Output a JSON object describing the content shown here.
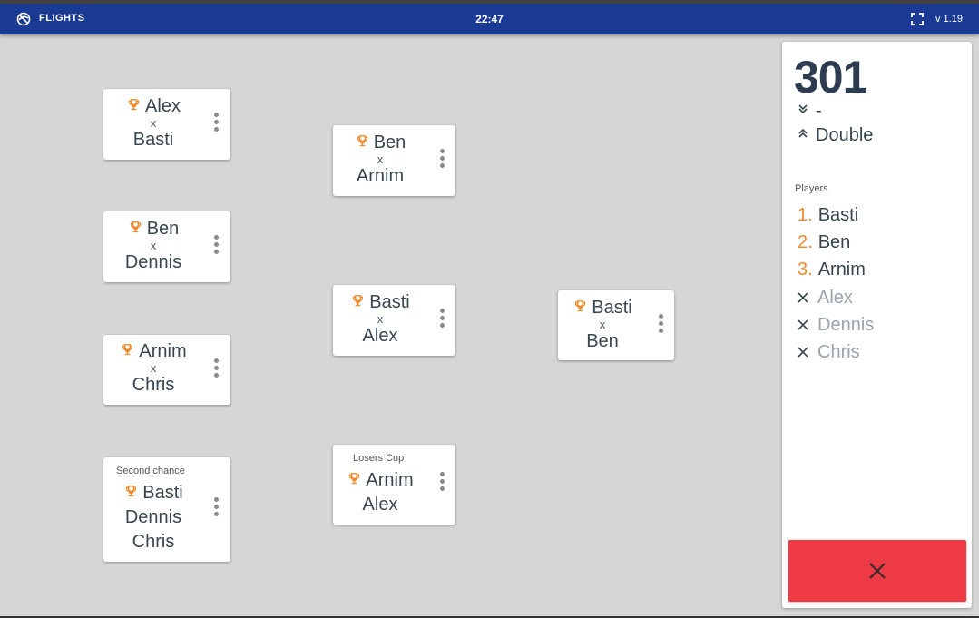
{
  "appbar": {
    "title": "FLIGHTS",
    "clock": "22:47",
    "version": "v 1.19",
    "bg_color": "#1a3a94",
    "fullscreen_icon": "fullscreen-icon",
    "logo_icon": "darts-logo-icon"
  },
  "bracket": {
    "x_label": "x",
    "round1": [
      {
        "winner": "Alex",
        "opponent": "Basti"
      },
      {
        "winner": "Ben",
        "opponent": "Dennis"
      },
      {
        "winner": "Arnim",
        "opponent": "Chris"
      },
      {
        "heading": "Second chance",
        "winner": "Basti",
        "others": [
          "Dennis",
          "Chris"
        ]
      }
    ],
    "round2": [
      {
        "winner": "Ben",
        "opponent": "Arnim"
      },
      {
        "winner": "Basti",
        "opponent": "Alex"
      },
      {
        "heading": "Losers Cup",
        "winner": "Arnim",
        "opponent": "Alex"
      }
    ],
    "final": {
      "winner": "Basti",
      "opponent": "Ben"
    },
    "trophy_color": "#ef8b2c"
  },
  "panel": {
    "score": "301",
    "in_mode": "-",
    "out_mode": "Double",
    "players_label": "Players",
    "ranked": [
      {
        "rank": "1.",
        "name": "Basti"
      },
      {
        "rank": "2.",
        "name": "Ben"
      },
      {
        "rank": "3.",
        "name": "Arnim"
      }
    ],
    "eliminated": [
      "Alex",
      "Dennis",
      "Chris"
    ],
    "close_color": "#ee3a44"
  }
}
